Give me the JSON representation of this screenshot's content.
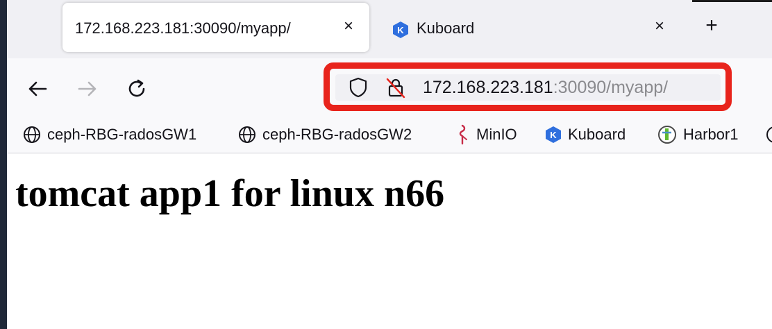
{
  "tabs": [
    {
      "title": "172.168.223.181:30090/myapp/",
      "close": "×",
      "active": true
    },
    {
      "title": "Kuboard",
      "close": "×",
      "icon": "kuboard-icon",
      "icon_letter": "K",
      "active": false
    }
  ],
  "new_tab": "+",
  "nav": {
    "back": "back-arrow-icon",
    "forward": "forward-arrow-icon",
    "reload": "reload-icon"
  },
  "url": {
    "host": "172.168.223.181",
    "rest": ":30090/myapp/",
    "highlight_color": "#e8241c"
  },
  "bookmarks": [
    {
      "label": "ceph-RBG-radosGW1",
      "icon": "globe-icon"
    },
    {
      "label": "ceph-RBG-radosGW2",
      "icon": "globe-icon"
    },
    {
      "label": "MinIO",
      "icon": "minio-icon"
    },
    {
      "label": "Kuboard",
      "icon": "kuboard-icon",
      "icon_letter": "K"
    },
    {
      "label": "Harbor1",
      "icon": "harbor-icon"
    }
  ],
  "page": {
    "heading": "tomcat app1 for linux n66"
  },
  "colors": {
    "kuboard_blue": "#2f6fde",
    "minio_red": "#c72c48"
  }
}
